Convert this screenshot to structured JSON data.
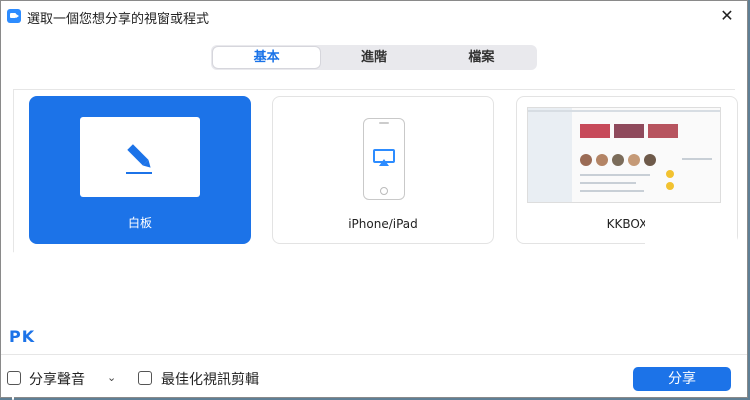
{
  "window": {
    "title": "選取一個您想分享的視窗或程式",
    "close_glyph": "✕"
  },
  "tabs": [
    {
      "label": "基本",
      "active": true
    },
    {
      "label": "進階",
      "active": false
    },
    {
      "label": "檔案",
      "active": false
    }
  ],
  "cards": [
    {
      "label": "白板",
      "icon": "pen-icon",
      "selected": true
    },
    {
      "label": "iPhone/iPad",
      "icon": "airplay-icon",
      "selected": false
    },
    {
      "label": "KKBOX",
      "icon": "window-thumbnail",
      "selected": false
    }
  ],
  "watermark": "PK",
  "bottom": {
    "share_sound_label": "分享聲音",
    "optimize_video_label": "最佳化視訊剪輯",
    "share_button_label": "分享"
  },
  "colors": {
    "accent": "#1c73e8",
    "text": "#222222"
  }
}
